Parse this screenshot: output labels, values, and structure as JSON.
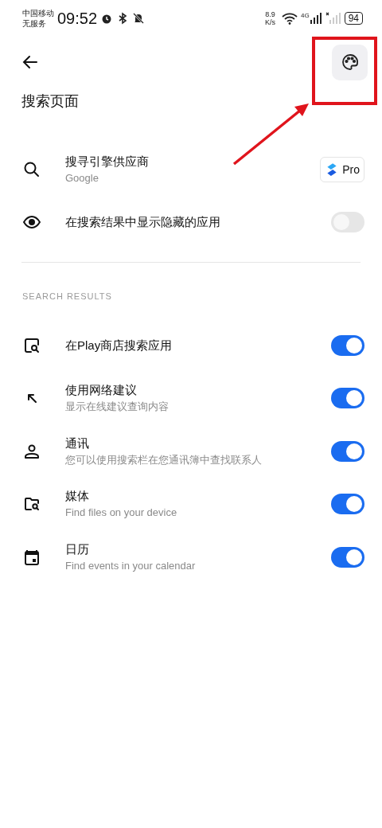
{
  "status_bar": {
    "carrier": "中国移动",
    "service": "无服务",
    "time": "09:52",
    "speed_value": "8.9",
    "speed_unit": "K/s",
    "network": "4G",
    "battery": "94"
  },
  "header": {
    "title": "搜索页面"
  },
  "settings": [
    {
      "kind": "pro",
      "title": "搜寻引擎供应商",
      "subtitle": "Google",
      "badge": "Pro"
    },
    {
      "kind": "toggle",
      "title": "在搜索结果中显示隐藏的应用",
      "on": false
    }
  ],
  "section": {
    "title": "SEARCH RESULTS",
    "items": [
      {
        "title": "在Play商店搜索应用",
        "on": true
      },
      {
        "title": "使用网络建议",
        "subtitle": "显示在线建议查询内容",
        "on": true
      },
      {
        "title": "通讯",
        "subtitle": "您可以使用搜索栏在您通讯簿中查找联系人",
        "on": true
      },
      {
        "title": "媒体",
        "subtitle": "Find files on your device",
        "on": true
      },
      {
        "title": "日历",
        "subtitle": "Find events in your calendar",
        "on": true
      }
    ]
  }
}
